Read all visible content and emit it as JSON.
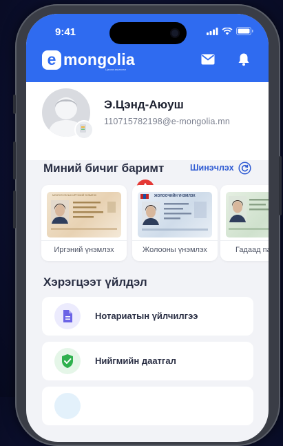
{
  "status_bar": {
    "time": "9:41"
  },
  "header": {
    "logo_letter": "e",
    "logo_text": "mongolia",
    "logo_subtitle": "Цахим засаглал"
  },
  "profile": {
    "name": "Э.Цэнд-Аюуш",
    "email": "110715782198@e-mongolia.mn"
  },
  "documents": {
    "title": "Миний бичиг баримт",
    "update_label": "Шинэчлэх",
    "items": [
      {
        "label": "Иргэний үнэмлэх",
        "card_header": "МОНГОЛ УЛСЫН ИРГЭНИЙ ҮНЭМЛЭХ",
        "warning": true
      },
      {
        "label": "Жолооны үнэмлэх",
        "card_header": "ЖОЛООЧИЙН ҮНЭМЛЭХ",
        "warning": false
      },
      {
        "label": "Гадаад па",
        "card_header": "",
        "warning": false
      }
    ]
  },
  "services": {
    "title": "Хэрэгцээт үйлдэл",
    "items": [
      {
        "label": "Нотариатын үйлчилгээ",
        "icon": "document-icon",
        "color": "#6b63e6"
      },
      {
        "label": "Нийгмийн даатгал",
        "icon": "shield-check-icon",
        "color": "#2fb14e"
      }
    ]
  },
  "colors": {
    "brand": "#2f6bf0",
    "warning": "#e53935"
  }
}
